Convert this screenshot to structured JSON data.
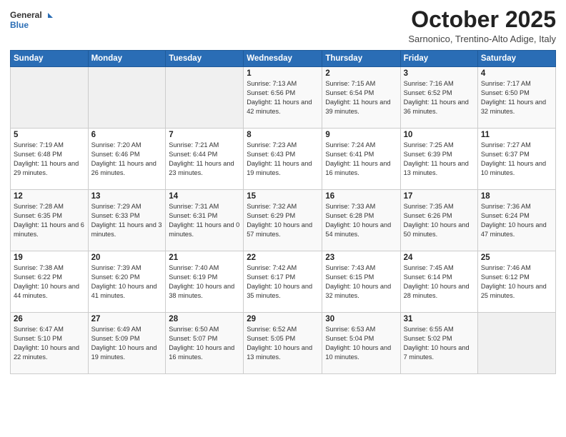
{
  "header": {
    "logo_line1": "General",
    "logo_line2": "Blue",
    "month": "October 2025",
    "location": "Sarnonico, Trentino-Alto Adige, Italy"
  },
  "weekdays": [
    "Sunday",
    "Monday",
    "Tuesday",
    "Wednesday",
    "Thursday",
    "Friday",
    "Saturday"
  ],
  "weeks": [
    [
      {
        "day": "",
        "info": ""
      },
      {
        "day": "",
        "info": ""
      },
      {
        "day": "",
        "info": ""
      },
      {
        "day": "1",
        "info": "Sunrise: 7:13 AM\nSunset: 6:56 PM\nDaylight: 11 hours and 42 minutes."
      },
      {
        "day": "2",
        "info": "Sunrise: 7:15 AM\nSunset: 6:54 PM\nDaylight: 11 hours and 39 minutes."
      },
      {
        "day": "3",
        "info": "Sunrise: 7:16 AM\nSunset: 6:52 PM\nDaylight: 11 hours and 36 minutes."
      },
      {
        "day": "4",
        "info": "Sunrise: 7:17 AM\nSunset: 6:50 PM\nDaylight: 11 hours and 32 minutes."
      }
    ],
    [
      {
        "day": "5",
        "info": "Sunrise: 7:19 AM\nSunset: 6:48 PM\nDaylight: 11 hours and 29 minutes."
      },
      {
        "day": "6",
        "info": "Sunrise: 7:20 AM\nSunset: 6:46 PM\nDaylight: 11 hours and 26 minutes."
      },
      {
        "day": "7",
        "info": "Sunrise: 7:21 AM\nSunset: 6:44 PM\nDaylight: 11 hours and 23 minutes."
      },
      {
        "day": "8",
        "info": "Sunrise: 7:23 AM\nSunset: 6:43 PM\nDaylight: 11 hours and 19 minutes."
      },
      {
        "day": "9",
        "info": "Sunrise: 7:24 AM\nSunset: 6:41 PM\nDaylight: 11 hours and 16 minutes."
      },
      {
        "day": "10",
        "info": "Sunrise: 7:25 AM\nSunset: 6:39 PM\nDaylight: 11 hours and 13 minutes."
      },
      {
        "day": "11",
        "info": "Sunrise: 7:27 AM\nSunset: 6:37 PM\nDaylight: 11 hours and 10 minutes."
      }
    ],
    [
      {
        "day": "12",
        "info": "Sunrise: 7:28 AM\nSunset: 6:35 PM\nDaylight: 11 hours and 6 minutes."
      },
      {
        "day": "13",
        "info": "Sunrise: 7:29 AM\nSunset: 6:33 PM\nDaylight: 11 hours and 3 minutes."
      },
      {
        "day": "14",
        "info": "Sunrise: 7:31 AM\nSunset: 6:31 PM\nDaylight: 11 hours and 0 minutes."
      },
      {
        "day": "15",
        "info": "Sunrise: 7:32 AM\nSunset: 6:29 PM\nDaylight: 10 hours and 57 minutes."
      },
      {
        "day": "16",
        "info": "Sunrise: 7:33 AM\nSunset: 6:28 PM\nDaylight: 10 hours and 54 minutes."
      },
      {
        "day": "17",
        "info": "Sunrise: 7:35 AM\nSunset: 6:26 PM\nDaylight: 10 hours and 50 minutes."
      },
      {
        "day": "18",
        "info": "Sunrise: 7:36 AM\nSunset: 6:24 PM\nDaylight: 10 hours and 47 minutes."
      }
    ],
    [
      {
        "day": "19",
        "info": "Sunrise: 7:38 AM\nSunset: 6:22 PM\nDaylight: 10 hours and 44 minutes."
      },
      {
        "day": "20",
        "info": "Sunrise: 7:39 AM\nSunset: 6:20 PM\nDaylight: 10 hours and 41 minutes."
      },
      {
        "day": "21",
        "info": "Sunrise: 7:40 AM\nSunset: 6:19 PM\nDaylight: 10 hours and 38 minutes."
      },
      {
        "day": "22",
        "info": "Sunrise: 7:42 AM\nSunset: 6:17 PM\nDaylight: 10 hours and 35 minutes."
      },
      {
        "day": "23",
        "info": "Sunrise: 7:43 AM\nSunset: 6:15 PM\nDaylight: 10 hours and 32 minutes."
      },
      {
        "day": "24",
        "info": "Sunrise: 7:45 AM\nSunset: 6:14 PM\nDaylight: 10 hours and 28 minutes."
      },
      {
        "day": "25",
        "info": "Sunrise: 7:46 AM\nSunset: 6:12 PM\nDaylight: 10 hours and 25 minutes."
      }
    ],
    [
      {
        "day": "26",
        "info": "Sunrise: 6:47 AM\nSunset: 5:10 PM\nDaylight: 10 hours and 22 minutes."
      },
      {
        "day": "27",
        "info": "Sunrise: 6:49 AM\nSunset: 5:09 PM\nDaylight: 10 hours and 19 minutes."
      },
      {
        "day": "28",
        "info": "Sunrise: 6:50 AM\nSunset: 5:07 PM\nDaylight: 10 hours and 16 minutes."
      },
      {
        "day": "29",
        "info": "Sunrise: 6:52 AM\nSunset: 5:05 PM\nDaylight: 10 hours and 13 minutes."
      },
      {
        "day": "30",
        "info": "Sunrise: 6:53 AM\nSunset: 5:04 PM\nDaylight: 10 hours and 10 minutes."
      },
      {
        "day": "31",
        "info": "Sunrise: 6:55 AM\nSunset: 5:02 PM\nDaylight: 10 hours and 7 minutes."
      },
      {
        "day": "",
        "info": ""
      }
    ]
  ]
}
